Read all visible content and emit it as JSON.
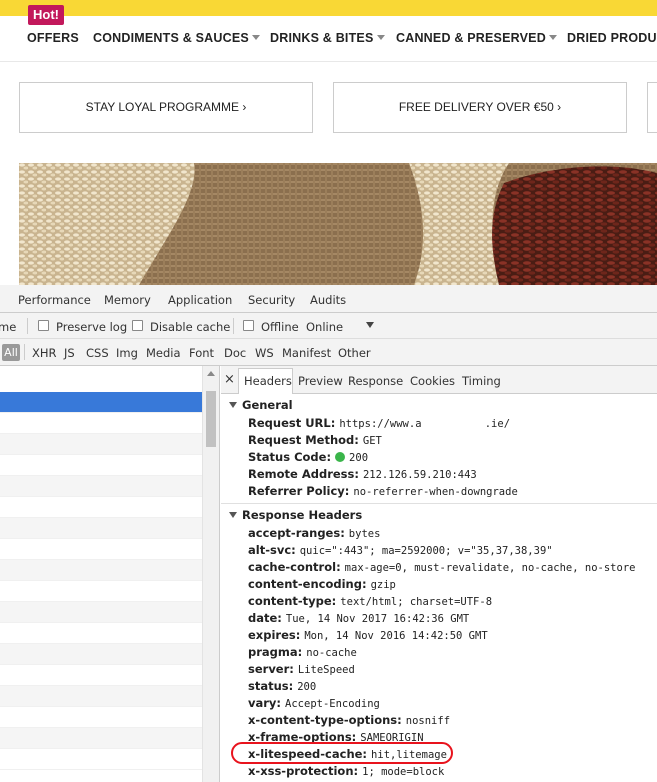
{
  "site": {
    "logo": "Hot!",
    "nav": [
      {
        "label": "OFFERS",
        "caret": false
      },
      {
        "label": "CONDIMENTS & SAUCES",
        "caret": true
      },
      {
        "label": "DRINKS & BITES",
        "caret": true
      },
      {
        "label": "CANNED & PRESERVED",
        "caret": true
      },
      {
        "label": "DRIED PRODUC",
        "caret": false
      }
    ],
    "promos": [
      "STAY LOYAL PROGRAMME ›",
      "FREE DELIVERY OVER €50 ›"
    ]
  },
  "devtools": {
    "tabs": [
      "Performance",
      "Memory",
      "Application",
      "Security",
      "Audits"
    ],
    "toolbar": {
      "name_fragment": "me",
      "preserve_log": "Preserve log",
      "disable_cache": "Disable cache",
      "offline": "Offline",
      "throttle": "Online"
    },
    "filters": [
      "All",
      "XHR",
      "JS",
      "CSS",
      "Img",
      "Media",
      "Font",
      "Doc",
      "WS",
      "Manifest",
      "Other"
    ],
    "detail_tabs": [
      "Headers",
      "Preview",
      "Response",
      "Cookies",
      "Timing"
    ],
    "close_symbol": "×",
    "general": {
      "title": "General",
      "rows": [
        {
          "key": "Request URL:",
          "value": "https://www.a          .ie/"
        },
        {
          "key": "Request Method:",
          "value": "GET"
        },
        {
          "key": "Status Code:",
          "value": "200",
          "status_dot": "#3ab54a"
        },
        {
          "key": "Remote Address:",
          "value": "212.126.59.210:443"
        },
        {
          "key": "Referrer Policy:",
          "value": "no-referrer-when-downgrade"
        }
      ]
    },
    "response_headers": {
      "title": "Response Headers",
      "rows": [
        {
          "key": "accept-ranges:",
          "value": "bytes"
        },
        {
          "key": "alt-svc:",
          "value": "quic=\":443\"; ma=2592000; v=\"35,37,38,39\""
        },
        {
          "key": "cache-control:",
          "value": "max-age=0, must-revalidate, no-cache, no-store"
        },
        {
          "key": "content-encoding:",
          "value": "gzip"
        },
        {
          "key": "content-type:",
          "value": "text/html; charset=UTF-8"
        },
        {
          "key": "date:",
          "value": "Tue, 14 Nov 2017 16:42:36 GMT"
        },
        {
          "key": "expires:",
          "value": "Mon, 14 Nov 2016 14:42:50 GMT"
        },
        {
          "key": "pragma:",
          "value": "no-cache"
        },
        {
          "key": "server:",
          "value": "LiteSpeed"
        },
        {
          "key": "status:",
          "value": "200"
        },
        {
          "key": "vary:",
          "value": "Accept-Encoding"
        },
        {
          "key": "x-content-type-options:",
          "value": "nosniff"
        },
        {
          "key": "x-frame-options:",
          "value": "SAMEORIGIN"
        },
        {
          "key": "x-litespeed-cache:",
          "value": "hit,litemage",
          "highlighted": true
        },
        {
          "key": "x-xss-protection:",
          "value": "1; mode=block"
        }
      ]
    },
    "colors": {
      "accent": "#1a73e8",
      "highlight_ring": "#e8131d",
      "brand": "#c2185b",
      "topbar": "#f9d835"
    }
  }
}
